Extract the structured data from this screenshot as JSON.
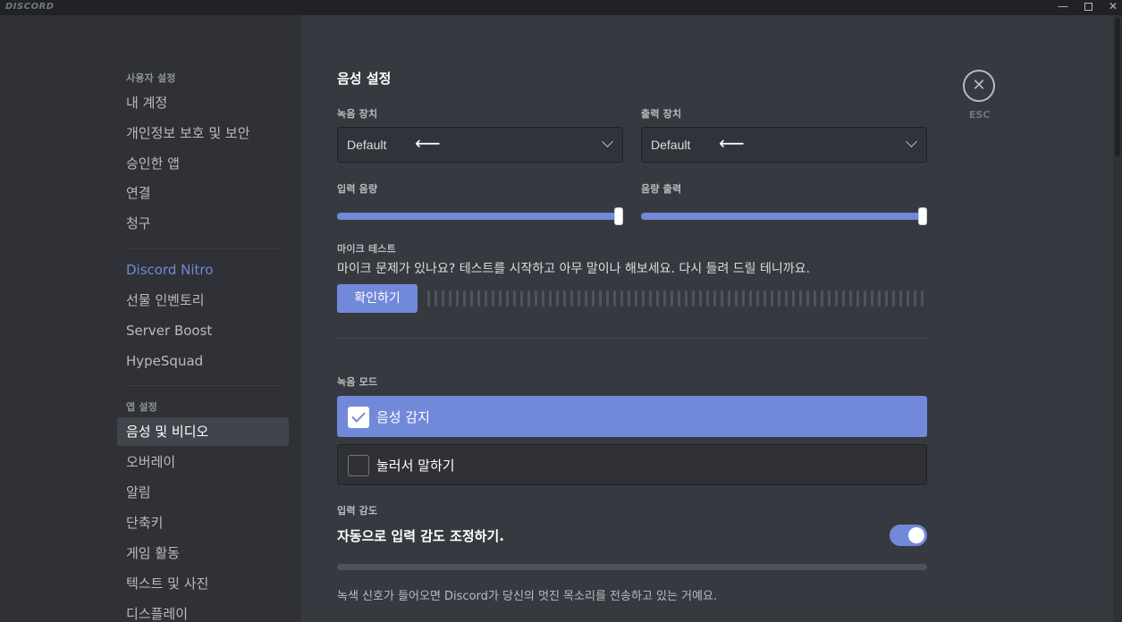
{
  "window": {
    "logo": "DISCORD",
    "minimize_glyph": "—",
    "close_glyph": "✕"
  },
  "sidebar": {
    "user_settings_header": "사용자 설정",
    "user_items": [
      "내 계정",
      "개인정보 보호 및 보안",
      "승인한 앱",
      "연결",
      "청구"
    ],
    "billing_items": [
      "Discord Nitro",
      "선물 인벤토리",
      "Server Boost",
      "HypeSquad"
    ],
    "app_settings_header": "앱 설정",
    "app_items": [
      "음성 및 비디오",
      "오버레이",
      "알림",
      "단축키",
      "게임 활동",
      "텍스트 및 사진",
      "디스플레이"
    ],
    "selected": "음성 및 비디오"
  },
  "main": {
    "title": "음성 설정",
    "input_device": {
      "label": "녹음 장치",
      "value": "Default",
      "pointer_glyph": "⟵"
    },
    "output_device": {
      "label": "출력 장치",
      "value": "Default",
      "pointer_glyph": "⟵"
    },
    "input_volume": {
      "label": "입력 음량",
      "level_percent": 100
    },
    "output_volume": {
      "label": "음량 출력",
      "level_percent": 100
    },
    "mic_test": {
      "label": "마이크 테스트",
      "description": "마이크 문제가 있나요? 테스트를 시작하고 아무 말이나 해보세요. 다시 들려 드릴 테니까요.",
      "button": "확인하기"
    },
    "input_mode": {
      "label": "녹음 모드",
      "options": [
        {
          "label": "음성 감지",
          "checked": true
        },
        {
          "label": "눌러서 말하기",
          "checked": false
        }
      ]
    },
    "sensitivity": {
      "label": "입력 감도",
      "title": "자동으로 입력 감도 조정하기.",
      "toggle_on": true,
      "description": "녹색 신호가 들어오면 Discord가 당신의 멋진 목소리를 전송하고 있는 거예요."
    }
  },
  "close": {
    "glyph": "✕",
    "label": "ESC"
  },
  "colors": {
    "accent": "#7289da",
    "background": "#36393f",
    "sidebar": "#2f3136"
  }
}
